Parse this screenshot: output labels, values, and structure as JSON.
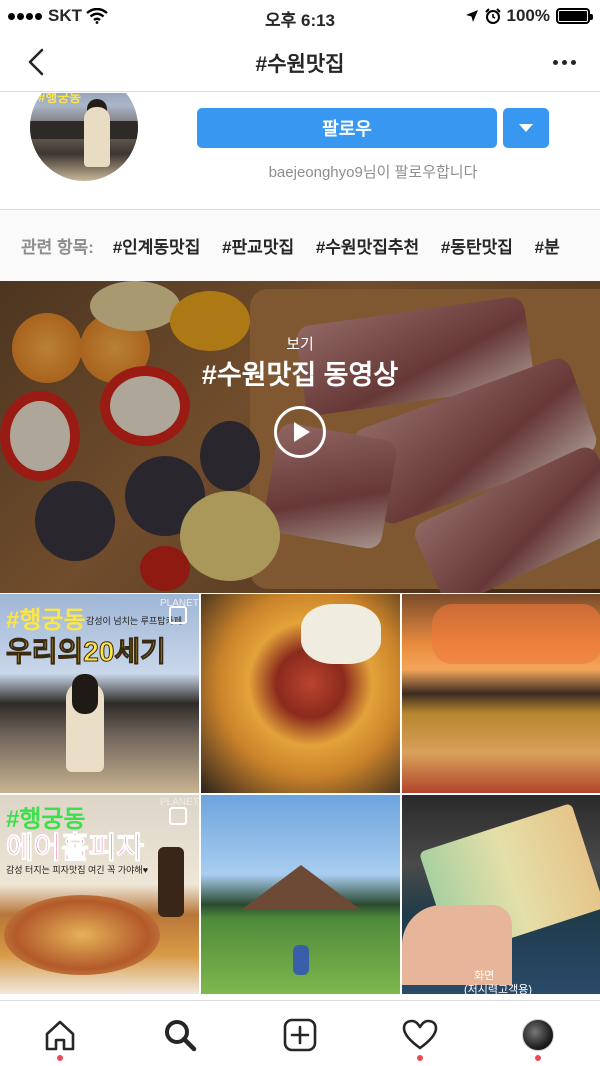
{
  "status_bar": {
    "carrier": "SKT",
    "time": "오후 6:13",
    "battery": "100%",
    "battery_level": 1.0
  },
  "nav": {
    "title": "#수원맛집",
    "back_icon": "chevron-left-icon",
    "more_icon": "more-horizontal-icon"
  },
  "profile": {
    "follow_label": "팔로우",
    "followed_by": "baejeonghyo9님이 팔로우합니다",
    "avatar_text": "#행궁동"
  },
  "related": {
    "label": "관련 항목:",
    "tags": [
      "#인계동맛집",
      "#판교맛집",
      "#수원맛집추천",
      "#동탄맛집",
      "#분"
    ]
  },
  "video": {
    "subtitle": "보기",
    "title": "#수원맛집 동영상"
  },
  "posts": [
    {
      "overlay_top": "#행궁동",
      "overlay_main": "우리의20세기",
      "overlay_small": "감성이 넘치는 루프탑카페",
      "watermark": "PLANET",
      "multi": true
    },
    {
      "multi": false
    },
    {
      "multi": false
    },
    {
      "overlay_top": "#행궁동",
      "overlay_main": "에어홀피자",
      "overlay_small": "감성 터지는 피자맛집 여긴 꼭 가야해♥",
      "watermark": "PLANET",
      "multi": true
    },
    {
      "multi": false
    },
    {
      "overlay_small": "화면",
      "overlay_caption": "(저시력고객용)",
      "multi": false
    }
  ],
  "tabbar": {
    "items": [
      "home-icon",
      "search-icon",
      "add-post-icon",
      "activity-heart-icon",
      "profile-avatar"
    ]
  },
  "colors": {
    "accent": "#3897f0",
    "notification_dot": "#ed4956",
    "overlay_yellow": "#fbe54a"
  }
}
